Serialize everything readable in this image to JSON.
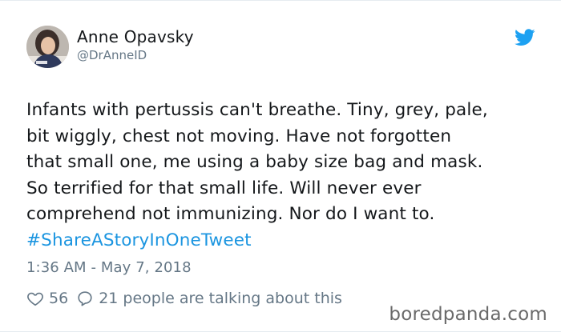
{
  "author": {
    "display_name": "Anne Opavsky",
    "handle": "@DrAnneID",
    "avatar_icon": "profile-photo"
  },
  "brand_icon": "twitter-bird-icon",
  "tweet": {
    "lines": [
      "Infants with pertussis can't breathe. Tiny, grey, pale,",
      "bit wiggly, chest not moving. Have not forgotten",
      "that small one, me using a baby size bag and mask.",
      "So terrified for that small life. Will never ever",
      "comprehend not immunizing. Nor do I want to."
    ],
    "hashtag": "#ShareAStoryInOneTweet"
  },
  "timestamp": "1:36 AM - May 7, 2018",
  "engagement": {
    "likes": "56",
    "comments": "21 people are talking about this"
  },
  "watermark": "boredpanda.com",
  "colors": {
    "text": "#14171a",
    "muted": "#657786",
    "link": "#1b95e0",
    "twitter_blue": "#1da1f2"
  }
}
